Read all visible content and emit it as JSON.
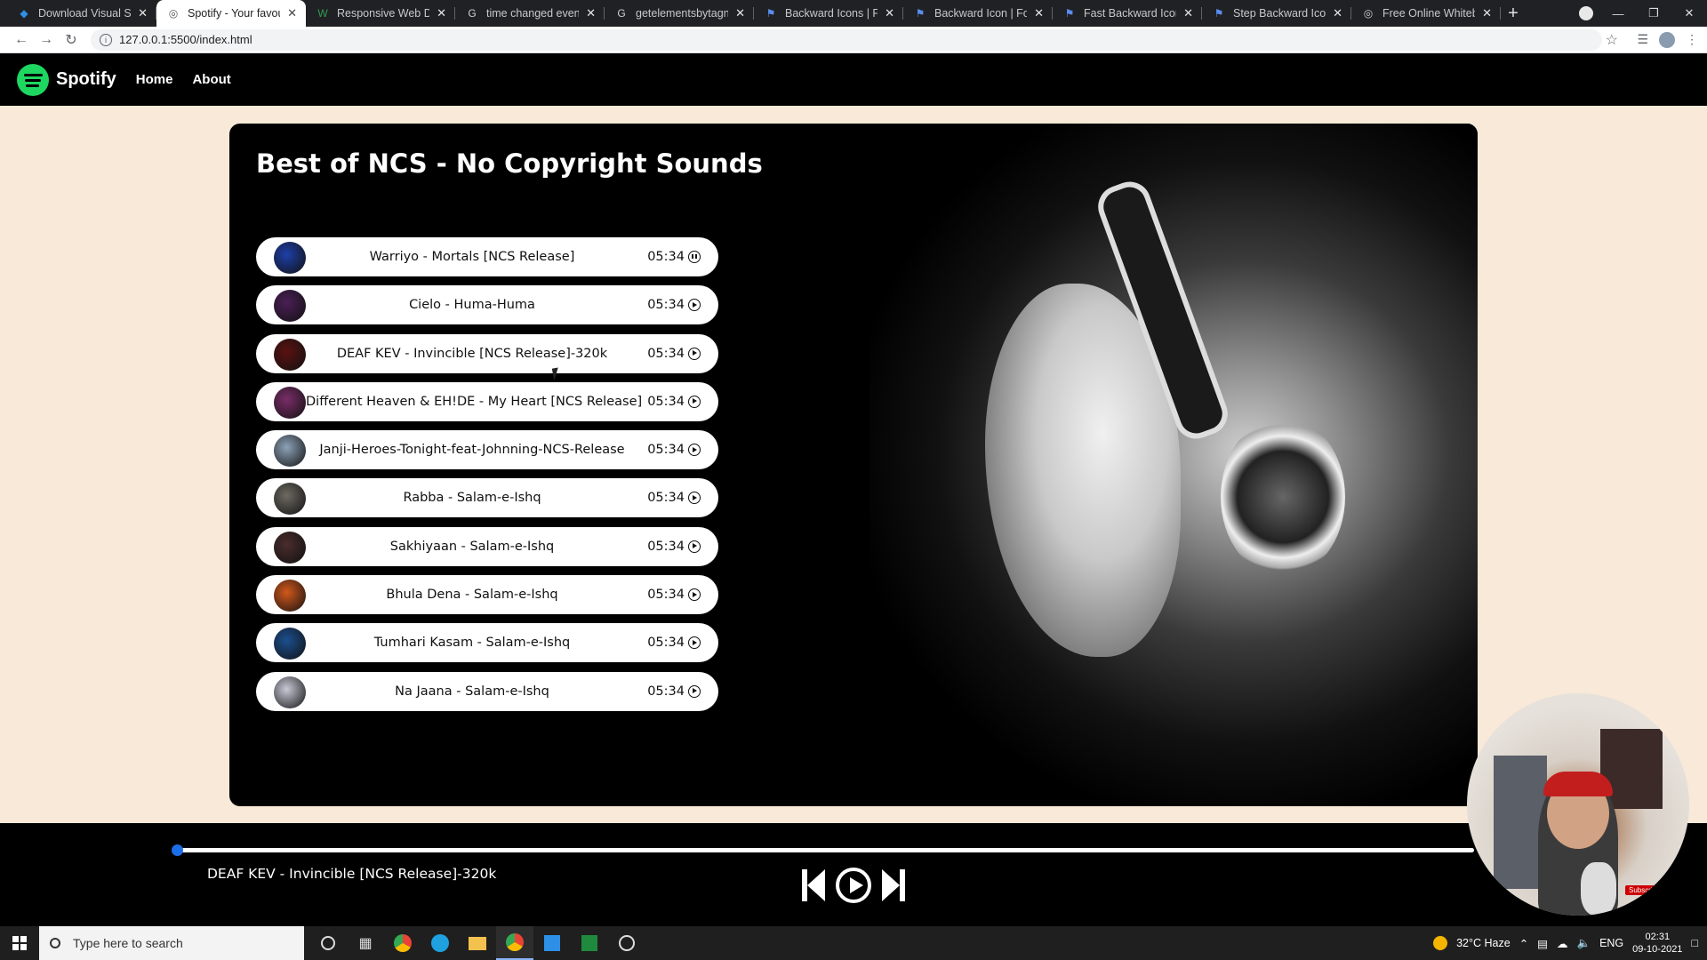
{
  "browser": {
    "tabs": [
      {
        "title": "Download Visual Studio",
        "icon": "vscode-icon",
        "icon_color": "#2d8fe6",
        "active": false
      },
      {
        "title": "Spotify - Your favourite",
        "icon": "globe-icon",
        "icon_color": "#555555",
        "active": true
      },
      {
        "title": "Responsive Web Design",
        "icon": "w3schools-icon",
        "icon_color": "#2f9c4e",
        "active": false
      },
      {
        "title": "time changed event of a",
        "icon": "google-icon",
        "icon_color": "#cfcfcf",
        "active": false
      },
      {
        "title": "getelementsbytagname",
        "icon": "google-icon",
        "icon_color": "#cfcfcf",
        "active": false
      },
      {
        "title": "Backward Icons | Font A",
        "icon": "flag-icon",
        "icon_color": "#5b8def",
        "active": false
      },
      {
        "title": "Backward Icon | Font Aw",
        "icon": "flag-icon",
        "icon_color": "#5b8def",
        "active": false
      },
      {
        "title": "Fast Backward Icon | Fo",
        "icon": "flag-icon",
        "icon_color": "#5b8def",
        "active": false
      },
      {
        "title": "Step Backward Icon | Fo",
        "icon": "flag-icon",
        "icon_color": "#5b8def",
        "active": false
      },
      {
        "title": "Free Online Whiteboard",
        "icon": "whiteboard-icon",
        "icon_color": "#cfcfcf",
        "active": false
      }
    ],
    "new_tab": "+",
    "url": "127.0.0.1:5500/index.html"
  },
  "site": {
    "brand": "Spotify",
    "brand_color": "#1ed760",
    "nav": [
      "Home",
      "About"
    ]
  },
  "playlist": {
    "title": "Best of NCS - No Copyright Sounds",
    "songs": [
      {
        "name": "Warriyo - Mortals [NCS Release]",
        "duration": "05:34",
        "cover_color": "#1e3fa8",
        "state": "pause"
      },
      {
        "name": "Cielo - Huma-Huma",
        "duration": "05:34",
        "cover_color": "#4a1f55",
        "state": "play"
      },
      {
        "name": "DEAF KEV - Invincible [NCS Release]-320k",
        "duration": "05:34",
        "cover_color": "#5a1111",
        "state": "play"
      },
      {
        "name": "Different Heaven & EH!DE - My Heart [NCS Release]",
        "duration": "05:34",
        "cover_color": "#7a2d68",
        "state": "play"
      },
      {
        "name": "Janji-Heroes-Tonight-feat-Johnning-NCS-Release",
        "duration": "05:34",
        "cover_color": "#8da2b8",
        "state": "play"
      },
      {
        "name": "Rabba - Salam-e-Ishq",
        "duration": "05:34",
        "cover_color": "#6d6a62",
        "state": "play"
      },
      {
        "name": "Sakhiyaan - Salam-e-Ishq",
        "duration": "05:34",
        "cover_color": "#4a2c2c",
        "state": "play"
      },
      {
        "name": "Bhula Dena - Salam-e-Ishq",
        "duration": "05:34",
        "cover_color": "#d2581b",
        "state": "play"
      },
      {
        "name": "Tumhari Kasam - Salam-e-Ishq",
        "duration": "05:34",
        "cover_color": "#1b4f8f",
        "state": "play"
      },
      {
        "name": "Na Jaana - Salam-e-Ishq",
        "duration": "05:34",
        "cover_color": "#c8c9d6",
        "state": "play"
      }
    ]
  },
  "player": {
    "now_playing": "DEAF KEV - Invincible [NCS Release]-320k",
    "progress": 0,
    "progress_color": "#1c6ee8"
  },
  "webcam": {
    "badge": "Subscribe"
  },
  "taskbar": {
    "search_placeholder": "Type here to search",
    "weather": "32°C  Haze",
    "language": "ENG",
    "time": "02:31",
    "date": "09-10-2021"
  }
}
